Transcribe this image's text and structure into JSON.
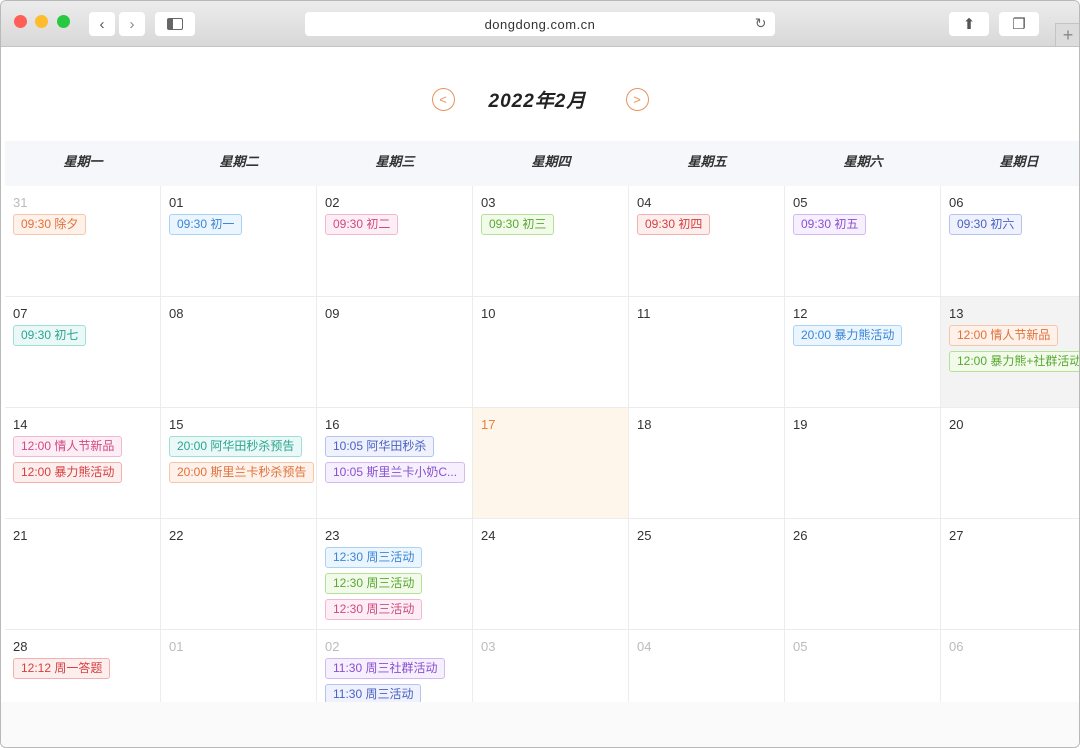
{
  "browser": {
    "url": "dongdong.com.cn"
  },
  "calendar": {
    "title": "2022年2月",
    "prev_icon": "chevron-left-circle",
    "next_icon": "chevron-right-circle",
    "weekdays": [
      "星期一",
      "星期二",
      "星期三",
      "星期四",
      "星期五",
      "星期六",
      "星期日"
    ],
    "colors": {
      "orange": [
        "#fdf1ea",
        "#f5c6aa",
        "#e0723a"
      ],
      "blue": [
        "#ebf5fe",
        "#a8d3f4",
        "#3b86d6"
      ],
      "pink": [
        "#fdeef5",
        "#f2b8d3",
        "#cf4a83"
      ],
      "green": [
        "#f2fbea",
        "#b6e09a",
        "#58a832"
      ],
      "red": [
        "#fdeeee",
        "#f3b0b0",
        "#d63f3f"
      ],
      "purple": [
        "#f6effd",
        "#d4b8f1",
        "#8a50cf"
      ],
      "indigo": [
        "#eff2fc",
        "#b6c3ee",
        "#4b62c2"
      ],
      "teal": [
        "#eaf9f7",
        "#9fdfd5",
        "#2aa590"
      ]
    },
    "days": [
      {
        "d": "31",
        "other": true,
        "events": [
          {
            "t": "09:30 除夕",
            "c": "orange"
          }
        ]
      },
      {
        "d": "01",
        "events": [
          {
            "t": "09:30 初一",
            "c": "blue"
          }
        ]
      },
      {
        "d": "02",
        "events": [
          {
            "t": "09:30 初二",
            "c": "pink"
          }
        ]
      },
      {
        "d": "03",
        "events": [
          {
            "t": "09:30 初三",
            "c": "green"
          }
        ]
      },
      {
        "d": "04",
        "events": [
          {
            "t": "09:30 初四",
            "c": "red"
          }
        ]
      },
      {
        "d": "05",
        "events": [
          {
            "t": "09:30 初五",
            "c": "purple"
          }
        ]
      },
      {
        "d": "06",
        "events": [
          {
            "t": "09:30 初六",
            "c": "indigo"
          }
        ]
      },
      {
        "d": "07",
        "events": [
          {
            "t": "09:30 初七",
            "c": "teal"
          }
        ]
      },
      {
        "d": "08",
        "events": []
      },
      {
        "d": "09",
        "events": []
      },
      {
        "d": "10",
        "events": []
      },
      {
        "d": "11",
        "events": []
      },
      {
        "d": "12",
        "events": [
          {
            "t": "20:00 暴力熊活动",
            "c": "blue"
          }
        ]
      },
      {
        "d": "13",
        "selected": true,
        "events": [
          {
            "t": "12:00 情人节新品",
            "c": "orange"
          },
          {
            "t": "12:00 暴力熊+社群活动",
            "c": "green"
          }
        ]
      },
      {
        "d": "14",
        "events": [
          {
            "t": "12:00 情人节新品",
            "c": "pink"
          },
          {
            "t": "12:00 暴力熊活动",
            "c": "red"
          }
        ]
      },
      {
        "d": "15",
        "events": [
          {
            "t": "20:00 阿华田秒杀预告",
            "c": "teal"
          },
          {
            "t": "20:00 斯里兰卡秒杀预告",
            "c": "orange"
          }
        ]
      },
      {
        "d": "16",
        "events": [
          {
            "t": "10:05 阿华田秒杀",
            "c": "indigo"
          },
          {
            "t": "10:05 斯里兰卡小奶C...",
            "c": "purple"
          }
        ]
      },
      {
        "d": "17",
        "today": true,
        "events": []
      },
      {
        "d": "18",
        "events": []
      },
      {
        "d": "19",
        "events": []
      },
      {
        "d": "20",
        "events": []
      },
      {
        "d": "21",
        "events": []
      },
      {
        "d": "22",
        "events": []
      },
      {
        "d": "23",
        "events": [
          {
            "t": "12:30 周三活动",
            "c": "blue"
          },
          {
            "t": "12:30 周三活动",
            "c": "green"
          },
          {
            "t": "12:30 周三活动",
            "c": "pink"
          }
        ]
      },
      {
        "d": "24",
        "events": []
      },
      {
        "d": "25",
        "events": []
      },
      {
        "d": "26",
        "events": []
      },
      {
        "d": "27",
        "events": []
      },
      {
        "d": "28",
        "events": [
          {
            "t": "12:12 周一答题",
            "c": "red"
          }
        ]
      },
      {
        "d": "01",
        "other": true,
        "events": []
      },
      {
        "d": "02",
        "other": true,
        "events": [
          {
            "t": "11:30 周三社群活动",
            "c": "purple"
          },
          {
            "t": "11:30 周三活动",
            "c": "indigo"
          }
        ]
      },
      {
        "d": "03",
        "other": true,
        "events": []
      },
      {
        "d": "04",
        "other": true,
        "events": []
      },
      {
        "d": "05",
        "other": true,
        "events": []
      },
      {
        "d": "06",
        "other": true,
        "events": []
      }
    ]
  }
}
